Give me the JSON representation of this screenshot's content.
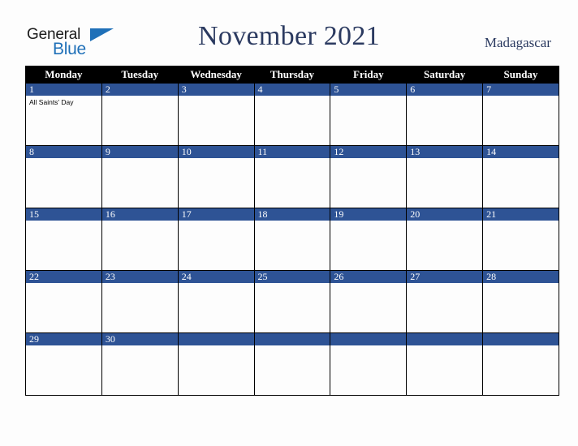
{
  "brand": {
    "name_part1": "General",
    "name_part2": "Blue",
    "triangle_icon": "triangle-icon",
    "colors": {
      "black": "#1b1b1b",
      "blue": "#1f70b8"
    }
  },
  "header": {
    "title": "November 2021",
    "country": "Madagascar",
    "title_color": "#2b3a60"
  },
  "calendar": {
    "month": "November",
    "year": "2021",
    "day_headers": [
      "Monday",
      "Tuesday",
      "Wednesday",
      "Thursday",
      "Friday",
      "Saturday",
      "Sunday"
    ],
    "header_bg": "#000000",
    "daynum_bg": "#2e5395",
    "cell_bg": "#fdfdfd",
    "weeks": [
      [
        {
          "day": "1",
          "events": [
            "All Saints' Day"
          ]
        },
        {
          "day": "2",
          "events": []
        },
        {
          "day": "3",
          "events": []
        },
        {
          "day": "4",
          "events": []
        },
        {
          "day": "5",
          "events": []
        },
        {
          "day": "6",
          "events": []
        },
        {
          "day": "7",
          "events": []
        }
      ],
      [
        {
          "day": "8",
          "events": []
        },
        {
          "day": "9",
          "events": []
        },
        {
          "day": "10",
          "events": []
        },
        {
          "day": "11",
          "events": []
        },
        {
          "day": "12",
          "events": []
        },
        {
          "day": "13",
          "events": []
        },
        {
          "day": "14",
          "events": []
        }
      ],
      [
        {
          "day": "15",
          "events": []
        },
        {
          "day": "16",
          "events": []
        },
        {
          "day": "17",
          "events": []
        },
        {
          "day": "18",
          "events": []
        },
        {
          "day": "19",
          "events": []
        },
        {
          "day": "20",
          "events": []
        },
        {
          "day": "21",
          "events": []
        }
      ],
      [
        {
          "day": "22",
          "events": []
        },
        {
          "day": "23",
          "events": []
        },
        {
          "day": "24",
          "events": []
        },
        {
          "day": "25",
          "events": []
        },
        {
          "day": "26",
          "events": []
        },
        {
          "day": "27",
          "events": []
        },
        {
          "day": "28",
          "events": []
        }
      ],
      [
        {
          "day": "29",
          "events": []
        },
        {
          "day": "30",
          "events": []
        },
        {
          "day": "",
          "events": []
        },
        {
          "day": "",
          "events": []
        },
        {
          "day": "",
          "events": []
        },
        {
          "day": "",
          "events": []
        },
        {
          "day": "",
          "events": []
        }
      ]
    ]
  }
}
